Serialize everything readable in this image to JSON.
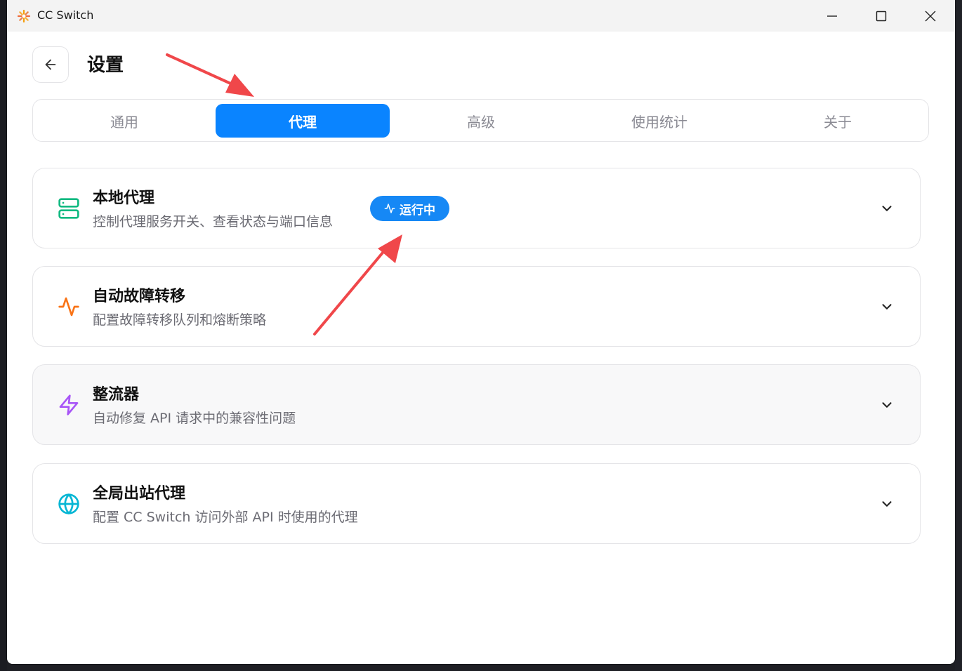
{
  "window": {
    "title": "CC Switch",
    "controls": [
      "minimize-icon",
      "maximize-icon",
      "close-icon"
    ]
  },
  "header": {
    "back_icon": "arrow-left-icon",
    "title": "设置"
  },
  "tabs": [
    {
      "label": "通用",
      "active": false
    },
    {
      "label": "代理",
      "active": true
    },
    {
      "label": "高级",
      "active": false
    },
    {
      "label": "使用统计",
      "active": false
    },
    {
      "label": "关于",
      "active": false
    }
  ],
  "sections": [
    {
      "title": "本地代理",
      "description": "控制代理服务开关、查看状态与端口信息",
      "icon": "server-icon",
      "icon_color": "#10b981",
      "badge": {
        "label": "运行中",
        "icon": "activity-icon",
        "color": "#1688f5"
      }
    },
    {
      "title": "自动故障转移",
      "description": "配置故障转移队列和熔断策略",
      "icon": "activity-icon",
      "icon_color": "#f97316"
    },
    {
      "title": "整流器",
      "description": "自动修复 API 请求中的兼容性问题",
      "icon": "zap-icon",
      "icon_color": "#a855f7"
    },
    {
      "title": "全局出站代理",
      "description": "配置 CC Switch 访问外部 API 时使用的代理",
      "icon": "globe-icon",
      "icon_color": "#06b6d4"
    }
  ],
  "colors": {
    "accent": "#0a84ff",
    "annotation_arrow": "#f0474a"
  }
}
